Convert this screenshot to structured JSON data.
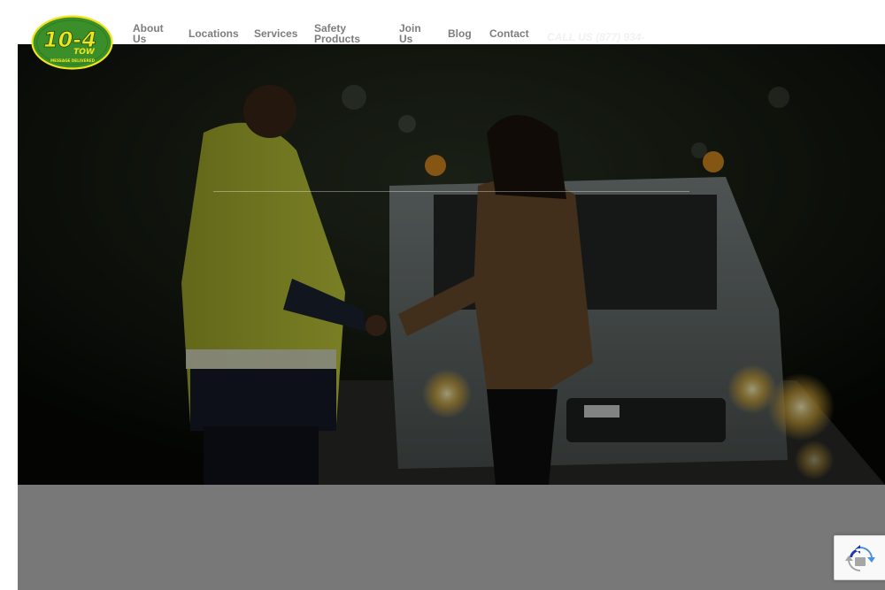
{
  "brand": {
    "logo_text": "10-4",
    "logo_subtext": "TOW",
    "logo_tagline": "MESSAGE DELIVERED",
    "colors": {
      "green": "#3a8f2a",
      "yellow": "#f0e41c",
      "nav_text": "#7d7d7d"
    }
  },
  "nav": {
    "about_line1": "About",
    "about_line2": "Us",
    "locations": "Locations",
    "services": "Services",
    "safety_line1": "Safety",
    "safety_line2": "Products",
    "join_line1": "Join",
    "join_line2": "Us",
    "blog": "Blog",
    "contact": "Contact"
  },
  "header": {
    "call_us": "CALL US (877) 934-"
  },
  "hero": {
    "image_icon": "hero-photo"
  },
  "recaptcha": {
    "icon": "recaptcha-icon"
  }
}
